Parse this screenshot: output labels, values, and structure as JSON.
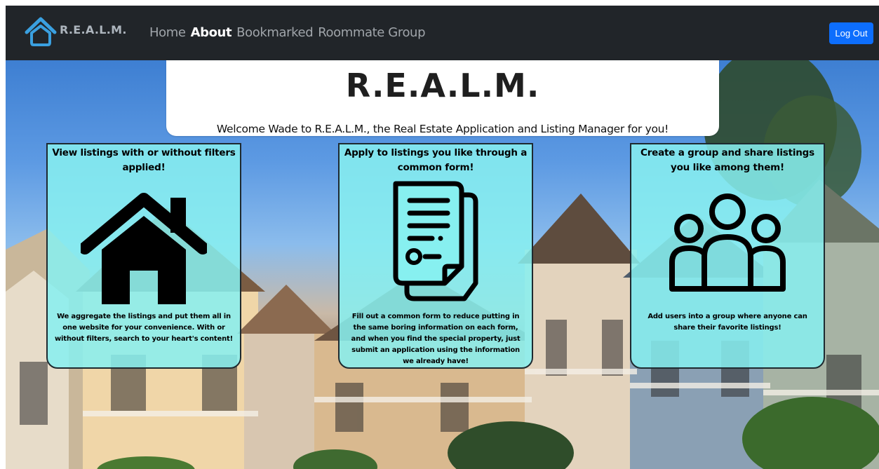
{
  "navbar": {
    "brand": "R.E.A.L.M.",
    "links": [
      {
        "label": "Home",
        "active": false
      },
      {
        "label": "About",
        "active": true
      },
      {
        "label": "Bookmarked",
        "active": false
      },
      {
        "label": "Roommate Group",
        "active": false
      }
    ],
    "logout_label": "Log Out"
  },
  "hero": {
    "title": "R.E.A.L.M.",
    "welcome": "Welcome Wade to R.E.A.L.M., the Real Estate Application and Listing Manager for you!"
  },
  "cards": [
    {
      "title": "View listings with or without filters applied!",
      "icon": "house-icon",
      "description": "We aggregate the listings and put them all in one website for your convenience. With or without filters, search to your heart's content!"
    },
    {
      "title": "Apply to listings you like through a common form!",
      "icon": "document-icon",
      "description": "Fill out a common form to reduce putting in the same boring information on each form, and when you find the special property, just submit an application using the information we already have!"
    },
    {
      "title": "Create a group and share listings you like among them!",
      "icon": "group-icon",
      "description": "Add users into a group where anyone can share their favorite listings!"
    }
  ],
  "colors": {
    "navbar_bg": "#212529",
    "logout_button": "#0d6efd",
    "logo_blue": "#3aa0e0",
    "card_bg": "#87f0f0",
    "card_border": "#1e2a30"
  }
}
